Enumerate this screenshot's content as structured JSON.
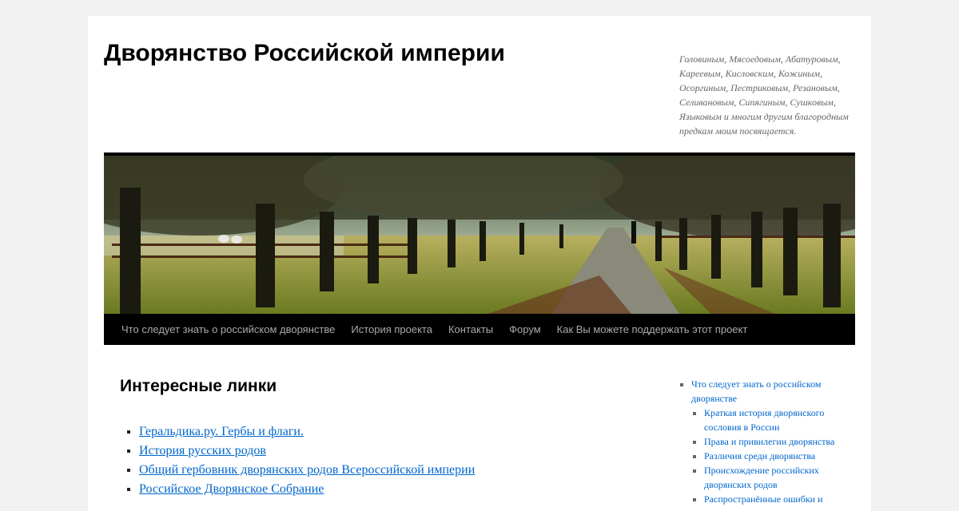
{
  "site": {
    "title": "Дворянство Российской империи",
    "description": "Головиным, Мясоедовым, Абатуровым, Кареевым, Кисловским, Кожиным, Осоргиным, Пестриковым, Резановым, Селивановым, Сипягиным, Сушковым, Языковым и многим другим благородным предкам моим посвящается."
  },
  "menu": {
    "items": [
      {
        "label": "Что следует знать о российском дворянстве"
      },
      {
        "label": "История проекта"
      },
      {
        "label": "Контакты"
      },
      {
        "label": "Форум"
      },
      {
        "label": "Как Вы можете поддержать этот проект"
      }
    ]
  },
  "content": {
    "title": "Интересные линки",
    "links": [
      {
        "label": "Геральдика.ру. Гербы и флаги."
      },
      {
        "label": "История русских родов"
      },
      {
        "label": "Общий гербовник дворянских родов Всероссийской империи"
      },
      {
        "label": "Российское Дворянское Собрание"
      }
    ]
  },
  "sidebar": {
    "top": {
      "label": "Что следует знать о российском дворянстве"
    },
    "children": [
      {
        "label": "Краткая история дворянского сословия в России"
      },
      {
        "label": "Права и привилегии дворянства"
      },
      {
        "label": "Различия среди дворянства"
      },
      {
        "label": "Происхождение российских дворянских родов"
      },
      {
        "label": "Распространённые ошибки и"
      }
    ]
  },
  "colors": {
    "link": "#0066cc",
    "menu_bg": "#000000",
    "page_bg": "#f1f1f1"
  }
}
